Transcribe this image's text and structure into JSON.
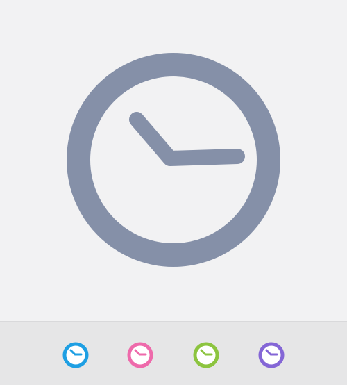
{
  "main_icon": {
    "name": "clock-icon",
    "color": "#8590a8"
  },
  "variants": [
    {
      "name": "clock-icon-blue",
      "color": "#1e9fe3"
    },
    {
      "name": "clock-icon-pink",
      "color": "#ee6aab"
    },
    {
      "name": "clock-icon-green",
      "color": "#8cc43f"
    },
    {
      "name": "clock-icon-purple",
      "color": "#8466d6"
    }
  ],
  "colors": {
    "background": "#f2f2f3",
    "bottom_bar": "#e6e6e7"
  }
}
